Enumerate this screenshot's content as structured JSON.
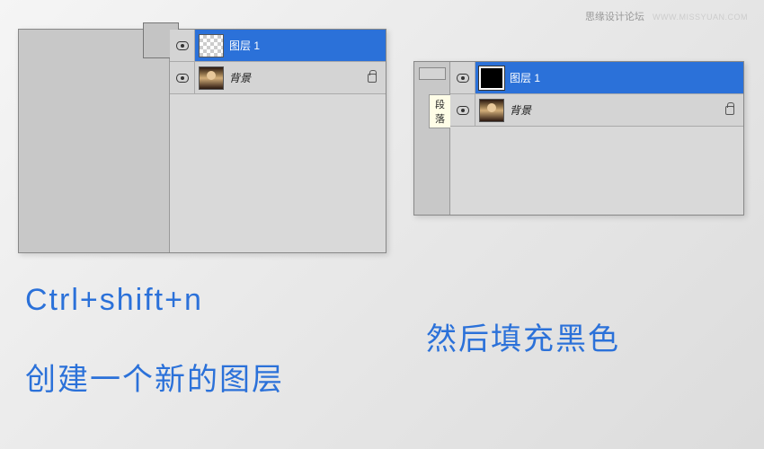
{
  "watermark": {
    "text": "思缘设计论坛",
    "url": "WWW.MISSYUAN.COM"
  },
  "panel_left": {
    "layer1": {
      "name": "图层 1"
    },
    "background": {
      "name": "背景"
    }
  },
  "panel_right": {
    "layer1": {
      "name": "图层 1"
    },
    "background": {
      "name": "背景"
    },
    "tooltip": "段落"
  },
  "captions": {
    "shortcut": "Ctrl+shift+n",
    "line1": "创建一个新的图层",
    "line2": "然后填充黑色"
  }
}
